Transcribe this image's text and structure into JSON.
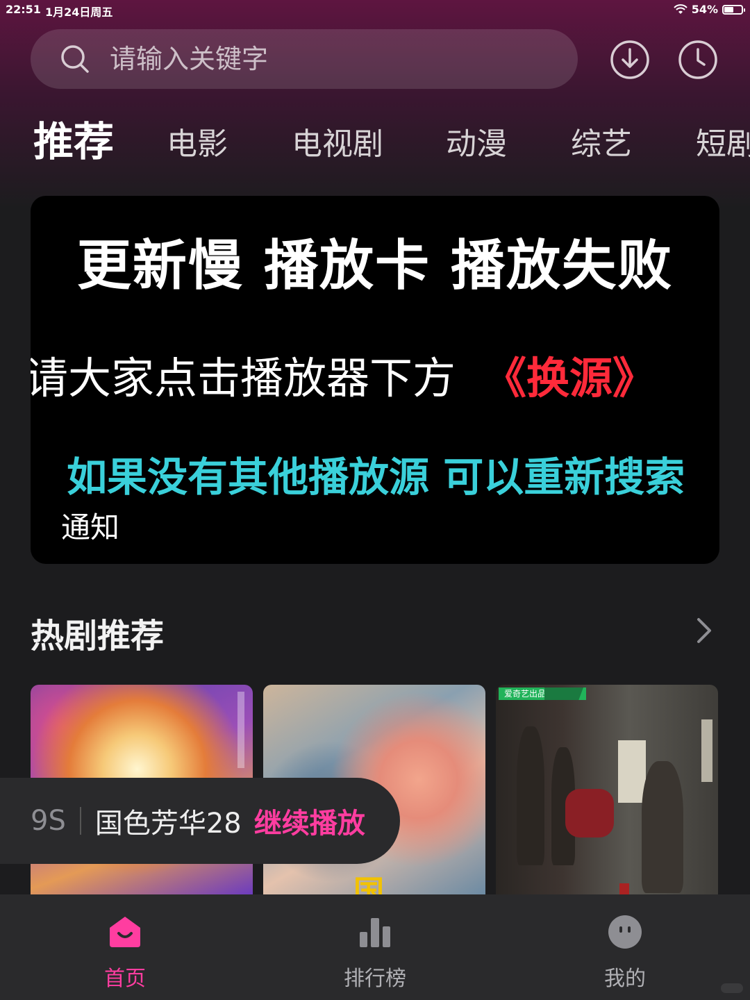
{
  "status_bar": {
    "time": "22:51",
    "date": "1月24日周五",
    "battery": "54%",
    "battery_level": 0.54
  },
  "search": {
    "placeholder": "请输入关键字"
  },
  "header_icons": {
    "download": "download-icon",
    "history": "history-clock-icon"
  },
  "tabs": [
    {
      "label": "推荐",
      "active": true
    },
    {
      "label": "电影"
    },
    {
      "label": "电视剧"
    },
    {
      "label": "动漫"
    },
    {
      "label": "综艺"
    },
    {
      "label": "短剧"
    }
  ],
  "banner": {
    "line1": "更新慢 播放卡 播放失败",
    "line2": "请大家点击播放器下方",
    "line2_accent": "《换源》",
    "line3": "如果没有其他播放源 可以重新搜索",
    "caption": "通知"
  },
  "section": {
    "title": "热剧推荐"
  },
  "posters": [
    {
      "poster_text": ""
    },
    {
      "poster_text": "国"
    },
    {
      "badge": "爱奇艺出品"
    }
  ],
  "continue_toast": {
    "countdown": "9S",
    "title": "国色芳华28",
    "action": "继续播放"
  },
  "bottom_nav": [
    {
      "label": "首页",
      "icon": "home-icon",
      "active": true
    },
    {
      "label": "排行榜",
      "icon": "ranking-bar-icon"
    },
    {
      "label": "我的",
      "icon": "profile-face-icon"
    }
  ],
  "colors": {
    "accent": "#ff3da0",
    "banner_red": "#ff2a3a",
    "banner_cyan": "#3ad0da"
  }
}
